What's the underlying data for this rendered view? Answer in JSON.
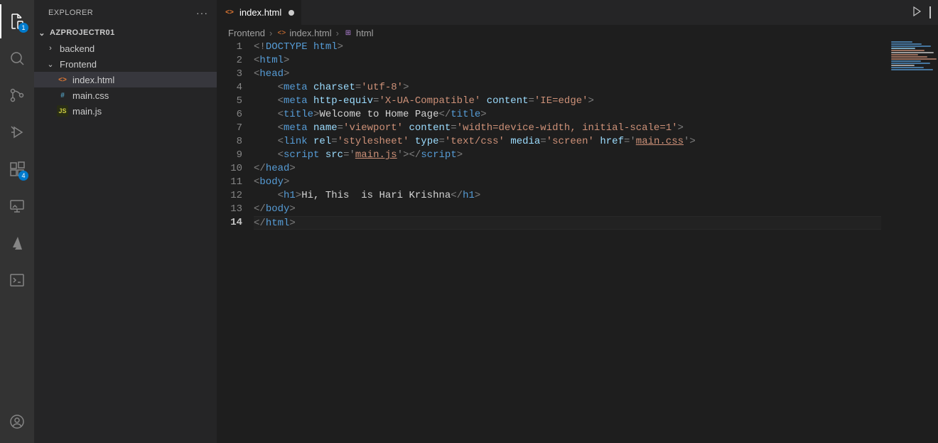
{
  "sidebar": {
    "title": "EXPLORER",
    "project": "AZPROJECTR01",
    "tree": [
      {
        "kind": "folder",
        "label": "backend",
        "expanded": false,
        "depth": 1
      },
      {
        "kind": "folder",
        "label": "Frontend",
        "expanded": true,
        "depth": 1
      },
      {
        "kind": "file",
        "label": "index.html",
        "ico": "html",
        "depth": 2,
        "selected": true
      },
      {
        "kind": "file",
        "label": "main.css",
        "ico": "css",
        "depth": 2
      },
      {
        "kind": "file",
        "label": "main.js",
        "ico": "js",
        "depth": 2
      }
    ]
  },
  "activity_badges": {
    "explorer": "1",
    "extensions": "4"
  },
  "tab": {
    "label": "index.html",
    "dirty": true
  },
  "breadcrumb": [
    {
      "label": "Frontend",
      "ico": ""
    },
    {
      "label": "index.html",
      "ico": "html"
    },
    {
      "label": "html",
      "ico": "struct"
    }
  ],
  "code": {
    "current_line": 14,
    "lines": [
      [
        [
          "punc",
          "<!"
        ],
        [
          "doct",
          "DOCTYPE"
        ],
        [
          "txt",
          " "
        ],
        [
          "tagn",
          "html"
        ],
        [
          "punc",
          ">"
        ]
      ],
      [
        [
          "punc",
          "<"
        ],
        [
          "tagn",
          "html"
        ],
        [
          "punc",
          ">"
        ]
      ],
      [
        [
          "punc",
          "<"
        ],
        [
          "tagn",
          "head"
        ],
        [
          "punc",
          ">"
        ]
      ],
      [
        [
          "txt",
          "    "
        ],
        [
          "punc",
          "<"
        ],
        [
          "tagn",
          "meta"
        ],
        [
          "txt",
          " "
        ],
        [
          "attr",
          "charset"
        ],
        [
          "punc",
          "="
        ],
        [
          "str",
          "'utf-8'"
        ],
        [
          "punc",
          ">"
        ]
      ],
      [
        [
          "txt",
          "    "
        ],
        [
          "punc",
          "<"
        ],
        [
          "tagn",
          "meta"
        ],
        [
          "txt",
          " "
        ],
        [
          "attr",
          "http-equiv"
        ],
        [
          "punc",
          "="
        ],
        [
          "str",
          "'X-UA-Compatible'"
        ],
        [
          "txt",
          " "
        ],
        [
          "attr",
          "content"
        ],
        [
          "punc",
          "="
        ],
        [
          "str",
          "'IE=edge'"
        ],
        [
          "punc",
          ">"
        ]
      ],
      [
        [
          "txt",
          "    "
        ],
        [
          "punc",
          "<"
        ],
        [
          "tagn",
          "title"
        ],
        [
          "punc",
          ">"
        ],
        [
          "txt",
          "Welcome to Home Page"
        ],
        [
          "punc",
          "</"
        ],
        [
          "tagn",
          "title"
        ],
        [
          "punc",
          ">"
        ]
      ],
      [
        [
          "txt",
          "    "
        ],
        [
          "punc",
          "<"
        ],
        [
          "tagn",
          "meta"
        ],
        [
          "txt",
          " "
        ],
        [
          "attr",
          "name"
        ],
        [
          "punc",
          "="
        ],
        [
          "str",
          "'viewport'"
        ],
        [
          "txt",
          " "
        ],
        [
          "attr",
          "content"
        ],
        [
          "punc",
          "="
        ],
        [
          "str",
          "'width=device-width, initial-scale=1'"
        ],
        [
          "punc",
          ">"
        ]
      ],
      [
        [
          "txt",
          "    "
        ],
        [
          "punc",
          "<"
        ],
        [
          "tagn",
          "link"
        ],
        [
          "txt",
          " "
        ],
        [
          "attr",
          "rel"
        ],
        [
          "punc",
          "="
        ],
        [
          "str",
          "'stylesheet'"
        ],
        [
          "txt",
          " "
        ],
        [
          "attr",
          "type"
        ],
        [
          "punc",
          "="
        ],
        [
          "str",
          "'text/css'"
        ],
        [
          "txt",
          " "
        ],
        [
          "attr",
          "media"
        ],
        [
          "punc",
          "="
        ],
        [
          "str",
          "'screen'"
        ],
        [
          "txt",
          " "
        ],
        [
          "attr",
          "href"
        ],
        [
          "punc",
          "="
        ],
        [
          "punc",
          "'"
        ],
        [
          "str ul",
          "main.css"
        ],
        [
          "punc",
          "'"
        ],
        [
          "punc",
          ">"
        ]
      ],
      [
        [
          "txt",
          "    "
        ],
        [
          "punc",
          "<"
        ],
        [
          "tagn",
          "script"
        ],
        [
          "txt",
          " "
        ],
        [
          "attr",
          "src"
        ],
        [
          "punc",
          "="
        ],
        [
          "punc",
          "'"
        ],
        [
          "str ul",
          "main.js"
        ],
        [
          "punc",
          "'"
        ],
        [
          "punc",
          "></"
        ],
        [
          "tagn",
          "script"
        ],
        [
          "punc",
          ">"
        ]
      ],
      [
        [
          "punc",
          "</"
        ],
        [
          "tagn",
          "head"
        ],
        [
          "punc",
          ">"
        ]
      ],
      [
        [
          "punc",
          "<"
        ],
        [
          "tagn",
          "body"
        ],
        [
          "punc",
          ">"
        ]
      ],
      [
        [
          "txt",
          "    "
        ],
        [
          "punc",
          "<"
        ],
        [
          "tagn",
          "h1"
        ],
        [
          "punc",
          ">"
        ],
        [
          "txt",
          "Hi, This  is Hari Krishna"
        ],
        [
          "punc",
          "</"
        ],
        [
          "tagn",
          "h1"
        ],
        [
          "punc",
          ">"
        ]
      ],
      [
        [
          "punc",
          "</"
        ],
        [
          "tagn",
          "body"
        ],
        [
          "punc",
          ">"
        ]
      ],
      [
        [
          "punc",
          "</"
        ],
        [
          "tagn",
          "html"
        ],
        [
          "punc",
          ">"
        ]
      ]
    ]
  },
  "minimap_colors": [
    "#569cd6",
    "#569cd6",
    "#569cd6",
    "#9cdcfe",
    "#ce9178",
    "#d4d4d4",
    "#ce9178",
    "#ce9178",
    "#ce9178",
    "#569cd6",
    "#569cd6",
    "#d4d4d4",
    "#569cd6",
    "#569cd6"
  ]
}
